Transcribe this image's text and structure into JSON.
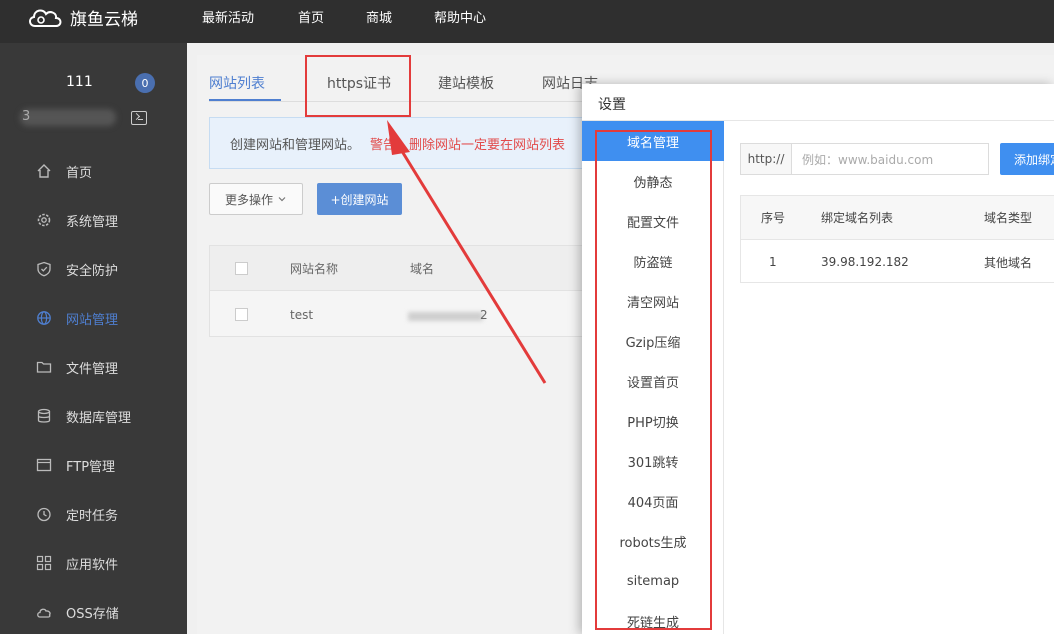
{
  "app": {
    "logo_text": "旗鱼云梯"
  },
  "topnav": [
    "最新活动",
    "首页",
    "商城",
    "帮助中心"
  ],
  "user": {
    "id": "111",
    "badge": "0",
    "masked_name": "3"
  },
  "sidebar": {
    "items": [
      {
        "label": "首页",
        "icon": "home-icon"
      },
      {
        "label": "系统管理",
        "icon": "gear-icon"
      },
      {
        "label": "安全防护",
        "icon": "shield-icon"
      },
      {
        "label": "网站管理",
        "icon": "globe-icon",
        "active": true
      },
      {
        "label": "文件管理",
        "icon": "folder-icon"
      },
      {
        "label": "数据库管理",
        "icon": "database-icon"
      },
      {
        "label": "FTP管理",
        "icon": "ftp-icon"
      },
      {
        "label": "定时任务",
        "icon": "clock-icon"
      },
      {
        "label": "应用软件",
        "icon": "apps-icon"
      },
      {
        "label": "OSS存储",
        "icon": "cloud-icon"
      }
    ]
  },
  "main": {
    "tabs": [
      "网站列表",
      "https证书",
      "建站模板",
      "网站日志"
    ],
    "notice": {
      "text": "创建网站和管理网站。",
      "warning": "警告：删除网站一定要在网站列表"
    },
    "more_ops_label": "更多操作",
    "create_label": "+创建网站",
    "table": {
      "headers": [
        "网站名称",
        "域名"
      ],
      "rows": [
        {
          "name": "test",
          "domain_suffix": "2"
        }
      ]
    }
  },
  "modal": {
    "title": "设置",
    "side_menu": [
      "域名管理",
      "伪静态",
      "配置文件",
      "防盗链",
      "清空网站",
      "Gzip压缩",
      "设置首页",
      "PHP切换",
      "301跳转",
      "404页面",
      "robots生成",
      "sitemap",
      "死链生成"
    ],
    "http_prefix": "http://",
    "domain_placeholder": "例如：www.baidu.com",
    "add_label": "添加绑定",
    "bind_table": {
      "headers": [
        "序号",
        "绑定域名列表",
        "域名类型"
      ],
      "rows": [
        {
          "index": "1",
          "domain": "39.98.192.182",
          "type": "其他域名"
        }
      ]
    }
  },
  "colors": {
    "topbar": "#2f2f2f",
    "sidebar": "#393939",
    "accent": "#3f8ff0",
    "annotation": "#e33b3b"
  }
}
